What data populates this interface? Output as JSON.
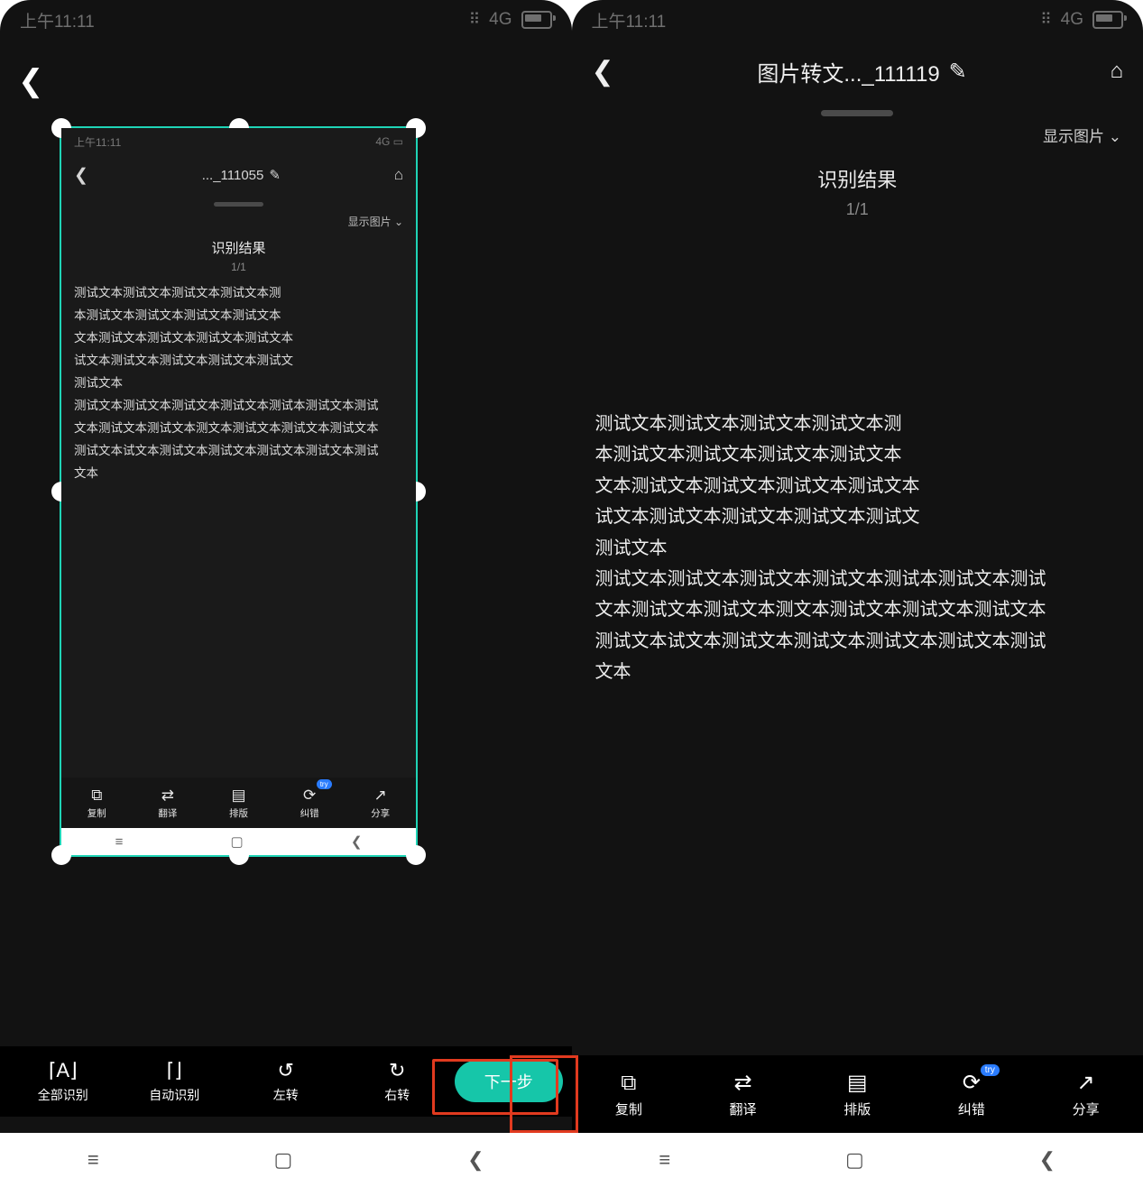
{
  "status_time": "上午11:11",
  "status_net": "4G",
  "left": {
    "crop_inner": {
      "title": "..._111055",
      "show_image": "显示图片",
      "result_title": "识别结果",
      "result_count": "1/1",
      "lines": [
        "测试文本测试文本测试文本测试文本测",
        "本测试文本测试文本测试文本测试文本",
        "文本测试文本测试文本测试文本测试文本",
        "试文本测试文本测试文本测试文本测试文",
        "测试文本",
        "测试文本测试文本测试文本测试文本测试本测试文本测试",
        "文本测试文本测试文本测文本测试文本测试文本测试文本",
        "测试文本试文本测试文本测试文本测试文本测试文本测试",
        "文本"
      ],
      "tools": [
        "复制",
        "翻译",
        "排版",
        "纠错",
        "分享"
      ],
      "try_badge": "try"
    },
    "toolbar": {
      "all": "全部识别",
      "auto": "自动识别",
      "rotate_left": "左转",
      "rotate_right": "右转",
      "next": "下一步"
    }
  },
  "right": {
    "title": "图片转文..._111119",
    "show_image": "显示图片",
    "result_title": "识别结果",
    "result_count": "1/1",
    "lines": [
      "测试文本测试文本测试文本测试文本测",
      "本测试文本测试文本测试文本测试文本",
      "文本测试文本测试文本测试文本测试文本",
      "试文本测试文本测试文本测试文本测试文",
      "测试文本",
      "测试文本测试文本测试文本测试文本测试本测试文本测试",
      "文本测试文本测试文本测文本测试文本测试文本测试文本",
      "测试文本试文本测试文本测试文本测试文本测试文本测试",
      "文本"
    ],
    "tools": {
      "copy": "复制",
      "translate": "翻译",
      "layout": "排版",
      "correct": "纠错",
      "share": "分享"
    },
    "try_badge": "try"
  }
}
